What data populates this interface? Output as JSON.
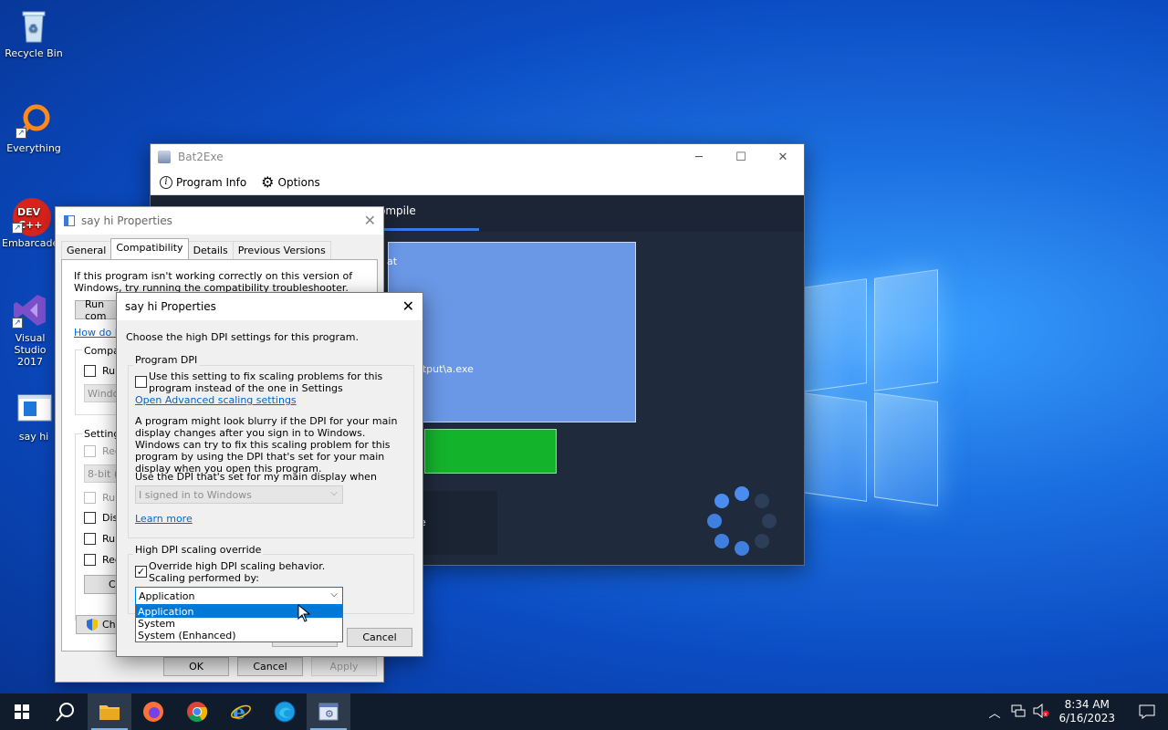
{
  "desktop": {
    "icons": [
      {
        "label": "Recycle Bin"
      },
      {
        "label": "Everything"
      },
      {
        "label": "Embarcadero Dev-C++"
      },
      {
        "label": "Visual Studio 2017"
      },
      {
        "label": "say hi"
      }
    ]
  },
  "bat2exe": {
    "title": "Bat2Exe",
    "menu": {
      "program_info": "Program Info",
      "options": "Options"
    },
    "tab_compile": "ompile",
    "panel_text_1": "at",
    "panel_text_2": "exe\\Output\\a.exe",
    "dark_text": "e"
  },
  "props": {
    "title": "say hi Properties",
    "tabs": [
      "General",
      "Compatibility",
      "Details",
      "Previous Versions"
    ],
    "intro": "If this program isn't working correctly on this version of Windows, try running the compatibility troubleshooter.",
    "run_compat_btn": "Run com",
    "how_link": "How do I",
    "compat_group": "Compati",
    "run_label": "Run",
    "windows_combo": "Window",
    "settings_group": "Settings",
    "reduced_label": "Redu",
    "color_combo": "8-bit (2",
    "run_label2": "Run",
    "disable_label": "Disal",
    "run_label3": "Run",
    "register_label": "Regis",
    "change_btn": "Ch",
    "change_all_btn": "Chai",
    "ok": "OK",
    "cancel": "Cancel",
    "apply": "Apply"
  },
  "dpi_dialog": {
    "title": "say hi Properties",
    "intro": "Choose the high DPI settings for this program.",
    "program_dpi_group": "Program DPI",
    "use_setting_label": "Use this setting to fix scaling problems for this program instead of the one in Settings",
    "advanced_link": "Open Advanced scaling settings",
    "blurry_text": "A program might look blurry if the DPI for your main display changes after you sign in to Windows. Windows can try to fix this scaling problem for this program by using the DPI that's set for your main display when you open this program.",
    "use_dpi_label": "Use the DPI that's set for my main display when",
    "signed_in_combo": "I signed in to Windows",
    "learn_more": "Learn more",
    "override_group": "High DPI scaling override",
    "override_label_1": "Override high DPI scaling behavior.",
    "override_label_2": "Scaling performed by:",
    "override_checked": true,
    "scaling_combo": "Application",
    "options": [
      "Application",
      "System",
      "System (Enhanced)"
    ],
    "selected_option": "Application",
    "cancel": "Cancel"
  },
  "taskbar": {
    "time": "8:34 AM",
    "date": "6/16/2023"
  },
  "colors": {
    "accent": "#0078d7",
    "bat_bg": "#1f2a3c",
    "bat_panel": "#6a97e6",
    "bat_green": "#14b32c",
    "taskbar": "#101c2c"
  }
}
